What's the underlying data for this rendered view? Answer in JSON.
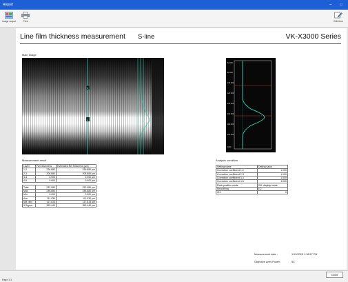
{
  "window": {
    "title": "Report",
    "controls": [
      "–",
      "□"
    ]
  },
  "toolbar": {
    "save_image_label": "Image output",
    "print_label": "Print",
    "edit_label": "Edit item"
  },
  "report": {
    "title": "Line film thickness measurement",
    "mode": "S-line",
    "series": "VK-X3000 Series",
    "main_image_label": "Main image",
    "measurement_result_label": "Measurement result",
    "analysis_condition_label": "Analysis condition",
    "image_markers": {
      "marker1": "1",
      "marker2": "2"
    },
    "profile_ticks": [
      "-60.000",
      "-80.000",
      "-100.000",
      "-120.000",
      "-140.000",
      "-160.000",
      "-180.000",
      "-200.000",
      "0.000"
    ]
  },
  "measurement_table": {
    "headers": [
      "Layer",
      "Film thickness",
      "Estimated film thickness [µm]"
    ],
    "rows": [
      [
        "1-2",
        "236.880",
        "236.880 µm"
      ],
      [
        "2-3",
        "208.880",
        "208.880 µm"
      ],
      [
        "3-4",
        "0.000",
        "0.000 µm"
      ],
      [
        "4-5",
        "0.000",
        "0.000 µm"
      ]
    ],
    "stats": [
      [
        "Total",
        "232.080",
        "232.080 µm"
      ],
      [
        "Max",
        "236.880",
        "236.880 µm"
      ],
      [
        "Min",
        "0.000",
        "0.000 µm"
      ],
      [
        "Ave.",
        "111.930",
        "111.930 µm"
      ],
      [
        "Std. dev",
        "117.813",
        "117.813 µm"
      ],
      [
        "3 Sigma",
        "353.440",
        "353.440 µm"
      ]
    ]
  },
  "analysis_table": {
    "headers": [
      "Setting name",
      "Setting value"
    ],
    "rows": [
      [
        "Correction coefficient 1-2",
        "1.000"
      ],
      [
        "Correction coefficient 2-3",
        "1.000"
      ],
      [
        "Correction coefficient 3-4",
        "1.000"
      ],
      [
        "Correction coefficient 4-5",
        "1.000"
      ],
      [
        "Peak position mode",
        "XXL display mode"
      ],
      [
        "Smoothing",
        "4.2"
      ],
      [
        "ID1",
        "0"
      ]
    ]
  },
  "meta": {
    "date_label": "Measurement date :",
    "date_value": "1/13/2025 1:18:57 PM",
    "lens_label": "Objective Lens Power :",
    "lens_value": "5X"
  },
  "status": {
    "left": "Page 1/1",
    "close_label": "Close"
  },
  "colors": {
    "accent": "#1f5fd6",
    "profile_line": "#2ec4a9"
  }
}
